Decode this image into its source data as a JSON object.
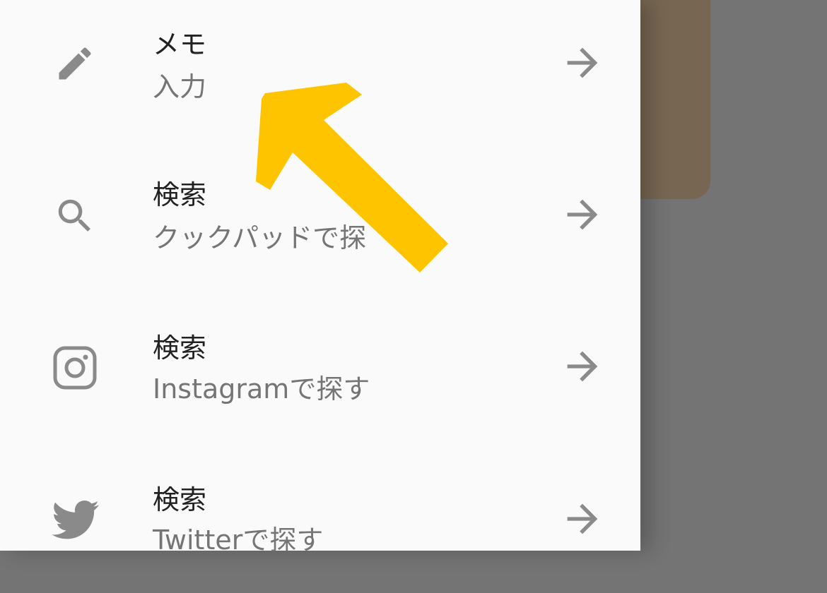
{
  "menu": {
    "items": [
      {
        "title": "メモ",
        "subtitle": "入力",
        "icon": "pencil-icon"
      },
      {
        "title": "検索",
        "subtitle": "クックパッドで探",
        "icon": "search-icon"
      },
      {
        "title": "検索",
        "subtitle": "Instagramで探す",
        "icon": "instagram-icon"
      },
      {
        "title": "検索",
        "subtitle": "Twitterで探す",
        "icon": "twitter-icon"
      }
    ]
  },
  "colors": {
    "drawer_bg": "#fafafa",
    "scrim": "#747474",
    "card_bg": "#776752",
    "icon_gray": "#8a8a8a",
    "title_text": "#212121",
    "subtitle_text": "#757575",
    "callout_arrow": "#ffc400"
  }
}
